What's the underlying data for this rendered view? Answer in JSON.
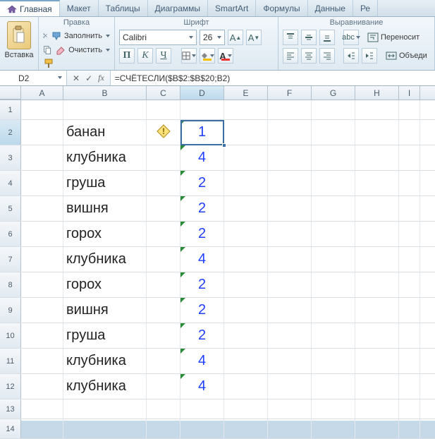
{
  "tabs": {
    "items": [
      "Главная",
      "Макет",
      "Таблицы",
      "Диаграммы",
      "SmartArt",
      "Формулы",
      "Данные",
      "Ре"
    ],
    "active_index": 0
  },
  "ribbon": {
    "paste": {
      "label": "Вставка"
    },
    "edit": {
      "group_label": "Правка",
      "fill_label": "Заполнить",
      "clear_label": "Очистить"
    },
    "font": {
      "group_label": "Шрифт",
      "name": "Calibri",
      "size": "26"
    },
    "align": {
      "group_label": "Выравнивание",
      "wrap_label": "Переносит",
      "merge_label": "Объеди"
    }
  },
  "formula_bar": {
    "name_box": "D2",
    "formula": "=СЧЁТЕСЛИ($B$2:$B$20;B2)"
  },
  "columns": [
    "A",
    "B",
    "C",
    "D",
    "E",
    "F",
    "G",
    "H",
    "I"
  ],
  "row_numbers": [
    "1",
    "2",
    "3",
    "4",
    "5",
    "6",
    "7",
    "8",
    "9",
    "10",
    "11",
    "12",
    "13",
    "14"
  ],
  "cells": {
    "B": [
      "",
      "банан",
      "клубника",
      "груша",
      "вишня",
      "горох",
      "клубника",
      "горох",
      "вишня",
      "груша",
      "клубника",
      "клубника",
      "",
      ""
    ],
    "D": [
      "",
      "1",
      "4",
      "2",
      "2",
      "2",
      "4",
      "2",
      "2",
      "2",
      "4",
      "4",
      "",
      ""
    ]
  },
  "selection": {
    "cell": "D2"
  },
  "chart_data": {
    "type": "table",
    "title": "СЧЁТЕСЛИ counts in column D for items in column B",
    "columns": [
      "B (item)",
      "D (count)"
    ],
    "rows": [
      [
        "банан",
        1
      ],
      [
        "клубника",
        4
      ],
      [
        "груша",
        2
      ],
      [
        "вишня",
        2
      ],
      [
        "горох",
        2
      ],
      [
        "клубника",
        4
      ],
      [
        "горох",
        2
      ],
      [
        "вишня",
        2
      ],
      [
        "груша",
        2
      ],
      [
        "клубника",
        4
      ],
      [
        "клубника",
        4
      ]
    ]
  }
}
